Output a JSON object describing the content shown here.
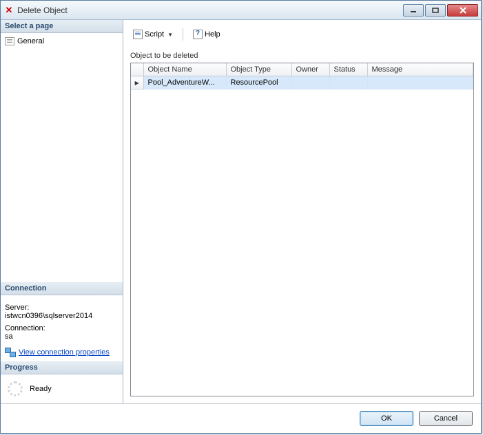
{
  "window": {
    "title": "Delete Object"
  },
  "sidebar": {
    "select_page_header": "Select a page",
    "pages": [
      {
        "label": "General"
      }
    ],
    "connection_header": "Connection",
    "server_label": "Server:",
    "server_value": "istwcn0396\\sqlserver2014",
    "connection_label": "Connection:",
    "connection_value": "sa",
    "view_conn_props": "View connection properties",
    "progress_header": "Progress",
    "progress_status": "Ready"
  },
  "toolbar": {
    "script_label": "Script",
    "help_label": "Help"
  },
  "table": {
    "caption": "Object to be deleted",
    "columns": [
      "Object Name",
      "Object Type",
      "Owner",
      "Status",
      "Message"
    ],
    "rows": [
      {
        "name": "Pool_AdventureW...",
        "type": "ResourcePool",
        "owner": "",
        "status": "",
        "message": ""
      }
    ]
  },
  "buttons": {
    "ok": "OK",
    "cancel": "Cancel"
  }
}
